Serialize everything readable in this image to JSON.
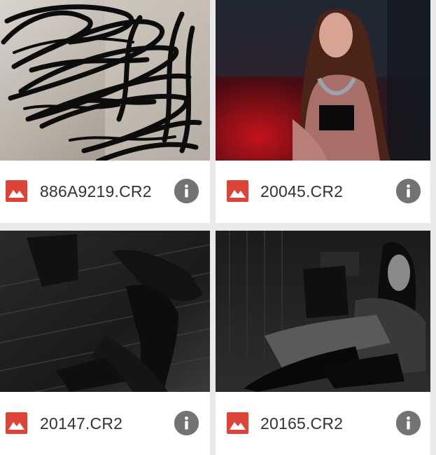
{
  "files": [
    {
      "name": "886A9219.CR2",
      "type_icon": "image-file-icon",
      "info_icon": "info-icon",
      "thumbnail": "scribbled-out photo"
    },
    {
      "name": "20045.CR2",
      "type_icon": "image-file-icon",
      "info_icon": "info-icon",
      "thumbnail": "portrait in red light"
    },
    {
      "name": "20147.CR2",
      "type_icon": "image-file-icon",
      "info_icon": "info-icon",
      "thumbnail": "dark black-and-white photo on wooden floor"
    },
    {
      "name": "20165.CR2",
      "type_icon": "image-file-icon",
      "info_icon": "info-icon",
      "thumbnail": "dark black-and-white photo seated"
    }
  ],
  "colors": {
    "file_icon_red": "#db4437",
    "info_button_gray": "#737373",
    "background": "#e9e9e9",
    "card": "#ffffff"
  }
}
